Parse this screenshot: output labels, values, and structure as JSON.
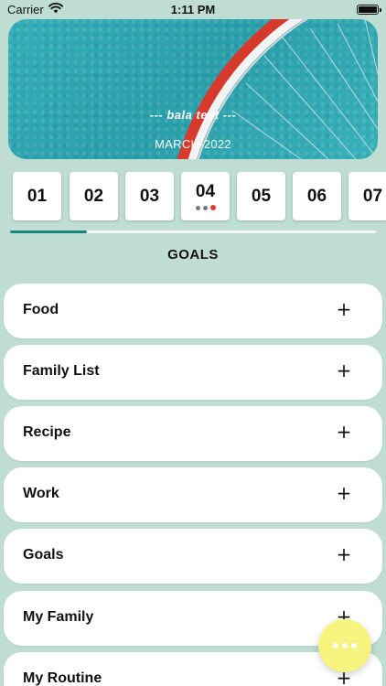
{
  "status_bar": {
    "carrier": "Carrier",
    "time": "1:11 PM",
    "wifi_icon": "wifi-icon",
    "battery_icon": "battery-icon"
  },
  "banner": {
    "title": "--- bala test ---",
    "month": "MARCH-2022"
  },
  "days": [
    {
      "label": "01",
      "dots": false
    },
    {
      "label": "02",
      "dots": false
    },
    {
      "label": "03",
      "dots": false
    },
    {
      "label": "04",
      "dots": true
    },
    {
      "label": "05",
      "dots": false
    },
    {
      "label": "06",
      "dots": false
    },
    {
      "label": "07",
      "dots": false
    }
  ],
  "day_progress": 0.21,
  "section_title": "GOALS",
  "goals": [
    {
      "label": "Food",
      "action": "+"
    },
    {
      "label": "Family List",
      "action": "+"
    },
    {
      "label": "Recipe",
      "action": "+"
    },
    {
      "label": "Work",
      "action": "+"
    },
    {
      "label": "Goals",
      "action": "+"
    },
    {
      "label": "My Family",
      "action": "+"
    },
    {
      "label": "My Routine",
      "action": "+"
    }
  ],
  "fab": {
    "icon": "more-dots-icon"
  },
  "colors": {
    "background": "#bfddd2",
    "accent": "#17867a",
    "fab": "#f6f37f",
    "dot_red": "#e53935"
  }
}
